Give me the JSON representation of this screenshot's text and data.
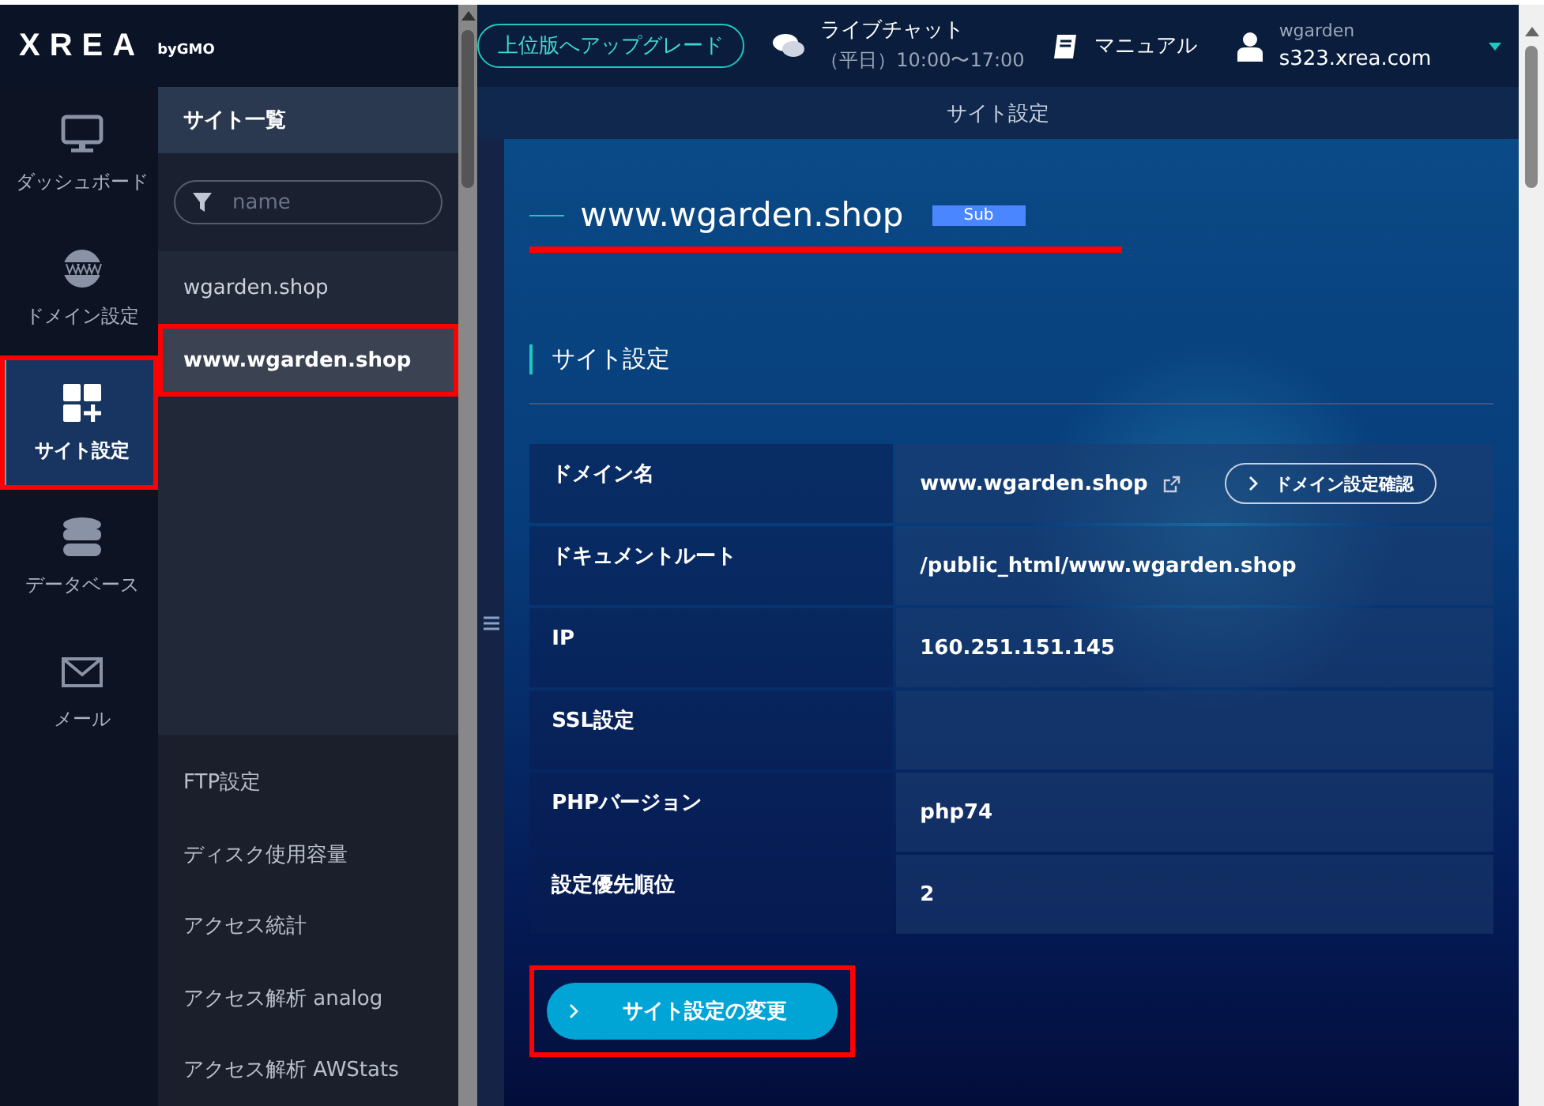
{
  "logo": {
    "name": "XREA",
    "byline": "byGMO"
  },
  "header": {
    "upgrade_button": "上位版へアップグレード",
    "chat": {
      "title": "ライブチャット",
      "hours": "（平日）10:00〜17:00"
    },
    "manual": "マニュアル",
    "account": {
      "user": "wgarden",
      "server": "s323.xrea.com"
    }
  },
  "nav": [
    {
      "kind": "monitor",
      "label": "ダッシュボード",
      "selected": false,
      "highlighted": false
    },
    {
      "kind": "globe",
      "label": "ドメイン設定",
      "selected": false,
      "highlighted": false
    },
    {
      "kind": "grid",
      "label": "サイト設定",
      "selected": true,
      "highlighted": true
    },
    {
      "kind": "database",
      "label": "データベース",
      "selected": false,
      "highlighted": false
    },
    {
      "kind": "mail",
      "label": "メール",
      "selected": false,
      "highlighted": false
    }
  ],
  "site_list": {
    "title": "サイト一覧",
    "filter": {
      "placeholder": "name"
    },
    "items": [
      {
        "label": "wgarden.shop",
        "selected": false,
        "highlighted": false
      },
      {
        "label": "www.wgarden.shop",
        "selected": true,
        "highlighted": true
      }
    ],
    "tools": [
      "FTP設定",
      "ディスク使用容量",
      "アクセス統計",
      "アクセス解析 analog",
      "アクセス解析 AWStats"
    ]
  },
  "page_title": "サイト設定",
  "site": {
    "name": "www.wgarden.shop",
    "badge": "Sub",
    "underlined": true
  },
  "section_title": "サイト設定",
  "table": {
    "rows": [
      {
        "label": "ドメイン名",
        "value": "www.wgarden.shop",
        "external_link": true,
        "button": "ドメイン設定確認"
      },
      {
        "label": "ドキュメントルート",
        "value": "/public_html/www.wgarden.shop"
      },
      {
        "label": "IP",
        "value": "160.251.151.145"
      },
      {
        "label": "SSL設定"
      },
      {
        "label": "PHPバージョン",
        "value": "php74"
      },
      {
        "label": "設定優先順位",
        "value": "2"
      }
    ]
  },
  "change_button": {
    "label": "サイト設定の変更",
    "highlighted": true
  }
}
